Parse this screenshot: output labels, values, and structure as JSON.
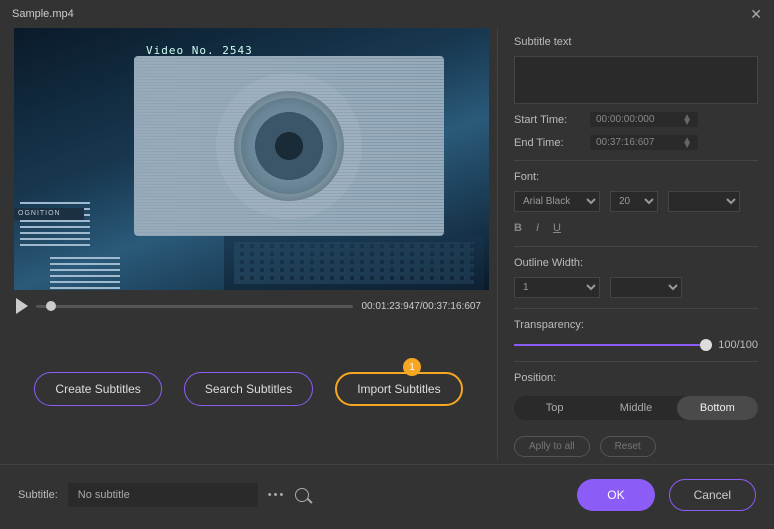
{
  "title": "Sample.mp4",
  "preview": {
    "hud": "Video No. 2543",
    "cogn": "OGNITION"
  },
  "playback": {
    "current": "00:01:23:947",
    "total": "00:37:16:607"
  },
  "buttons": {
    "create": "Create Subtitles",
    "search": "Search Subtitles",
    "import": "Import Subtitles",
    "badge": "1"
  },
  "panel": {
    "subtitle_text_label": "Subtitle text",
    "subtitle_text": "",
    "start_label": "Start Time:",
    "start": "00:00:00:000",
    "end_label": "End Time:",
    "end": "00:37:16:607",
    "font_label": "Font:",
    "font_name": "Arial Black",
    "font_size": "20",
    "bold": "B",
    "italic": "I",
    "underline": "U",
    "outline_label": "Outline Width:",
    "outline_width": "1",
    "transparency_label": "Transparency:",
    "transparency_value": "100/100",
    "position_label": "Position:",
    "positions": {
      "top": "Top",
      "middle": "Middle",
      "bottom": "Bottom"
    },
    "apply": "Aplly to all",
    "reset": "Reset"
  },
  "footer": {
    "subtitle_label": "Subtitle:",
    "subtitle_value": "No subtitle",
    "ok": "OK",
    "cancel": "Cancel"
  }
}
